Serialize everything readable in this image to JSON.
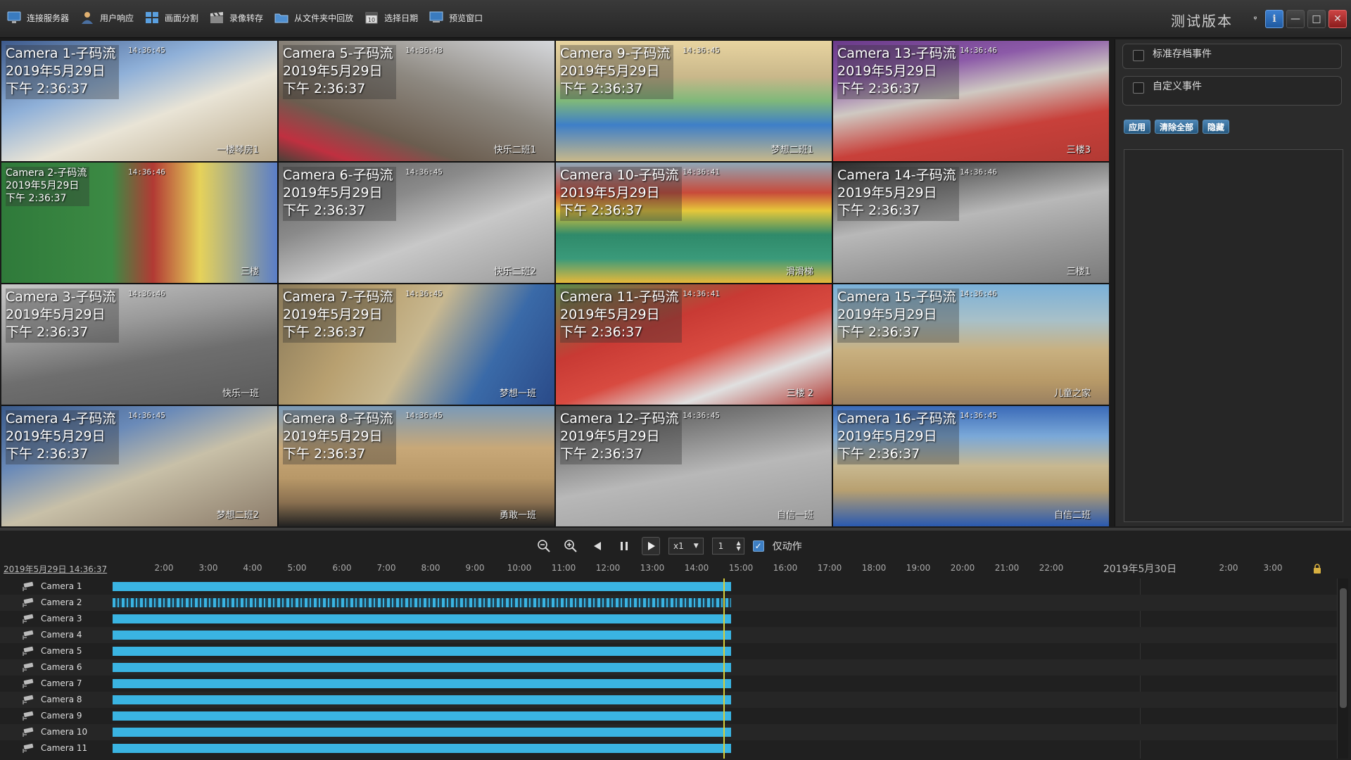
{
  "toolbar": {
    "items": [
      {
        "label": "连接服务器",
        "icon": "server-connect-icon"
      },
      {
        "label": "用户响应",
        "icon": "user-icon"
      },
      {
        "label": "画面分割",
        "icon": "grid-split-icon"
      },
      {
        "label": "录像转存",
        "icon": "clapper-icon"
      },
      {
        "label": "从文件夹中回放",
        "icon": "folder-icon"
      },
      {
        "label": "选择日期",
        "icon": "calendar-icon"
      },
      {
        "label": "预览窗口",
        "icon": "monitor-icon"
      }
    ],
    "brand": "测试版本",
    "window_buttons": {
      "pin": "ᵠ",
      "info": "i",
      "minimize": "—",
      "maximize": "□",
      "close": "✕"
    }
  },
  "cameras": [
    {
      "title": "Camera 1-子码流",
      "date": "2019年5月29日",
      "time": "下午 2:36:37",
      "osd_time": "14:36:45",
      "room": "一楼琴房1"
    },
    {
      "title": "Camera 5-子码流",
      "date": "2019年5月29日",
      "time": "下午 2:36:37",
      "osd_time": "14:36:43",
      "room": "快乐二班1"
    },
    {
      "title": "Camera 9-子码流",
      "date": "2019年5月29日",
      "time": "下午 2:36:37",
      "osd_time": "14:36:45",
      "room": "梦想二班1"
    },
    {
      "title": "Camera 13-子码流",
      "date": "2019年5月29日",
      "time": "下午 2:36:37",
      "osd_time": "14:36:46",
      "room": "三楼3"
    },
    {
      "title": "Camera 2-子码流",
      "date": "2019年5月29日",
      "time": "下午 2:36:37",
      "osd_time": "14:36:46",
      "room": "三楼"
    },
    {
      "title": "Camera 6-子码流",
      "date": "2019年5月29日",
      "time": "下午 2:36:37",
      "osd_time": "14:36:45",
      "room": "快乐二班2"
    },
    {
      "title": "Camera 10-子码流",
      "date": "2019年5月29日",
      "time": "下午 2:36:37",
      "osd_time": "14:36:41",
      "room": "滑滑梯"
    },
    {
      "title": "Camera 14-子码流",
      "date": "2019年5月29日",
      "time": "下午 2:36:37",
      "osd_time": "14:36:46",
      "room": "三楼1"
    },
    {
      "title": "Camera 3-子码流",
      "date": "2019年5月29日",
      "time": "下午 2:36:37",
      "osd_time": "14:36:46",
      "room": "快乐一班"
    },
    {
      "title": "Camera 7-子码流",
      "date": "2019年5月29日",
      "time": "下午 2:36:37",
      "osd_time": "14:36:45",
      "room": "梦想一班"
    },
    {
      "title": "Camera 11-子码流",
      "date": "2019年5月29日",
      "time": "下午 2:36:37",
      "osd_time": "14:36:41",
      "room": "三楼 2"
    },
    {
      "title": "Camera 15-子码流",
      "date": "2019年5月29日",
      "time": "下午 2:36:37",
      "osd_time": "14:36:46",
      "room": "儿童之家"
    },
    {
      "title": "Camera 4-子码流",
      "date": "2019年5月29日",
      "time": "下午 2:36:37",
      "osd_time": "14:36:45",
      "room": "梦想二班2"
    },
    {
      "title": "Camera 8-子码流",
      "date": "2019年5月29日",
      "time": "下午 2:36:37",
      "osd_time": "14:36:45",
      "room": "勇敢一班"
    },
    {
      "title": "Camera 12-子码流",
      "date": "2019年5月29日",
      "time": "下午 2:36:37",
      "osd_time": "14:36:45",
      "room": "自信一班"
    },
    {
      "title": "Camera 16-子码流",
      "date": "2019年5月29日",
      "time": "下午 2:36:37",
      "osd_time": "14:36:45",
      "room": "自信二班"
    }
  ],
  "right_panel": {
    "events": [
      {
        "label": "标准存档事件",
        "checked": false
      },
      {
        "label": "自定义事件",
        "checked": false
      }
    ],
    "buttons": {
      "apply": "应用",
      "clear_all": "清除全部",
      "hide": "隐藏"
    }
  },
  "playback": {
    "speed": "x1",
    "step": "1",
    "motion_only_label": "仅动作",
    "motion_only_checked": true
  },
  "timeline": {
    "current": "2019年5月29日 14:36:37",
    "hours": [
      "2:00",
      "3:00",
      "4:00",
      "5:00",
      "6:00",
      "7:00",
      "8:00",
      "9:00",
      "10:00",
      "11:00",
      "12:00",
      "13:00",
      "14:00",
      "15:00",
      "16:00",
      "17:00",
      "18:00",
      "19:00",
      "20:00",
      "21:00",
      "22:00",
      "2019年5月30日",
      "2:00",
      "3:00"
    ],
    "tracks": [
      "Camera 1",
      "Camera 2",
      "Camera 3",
      "Camera 4",
      "Camera 5",
      "Camera 6",
      "Camera 7",
      "Camera 8",
      "Camera 9",
      "Camera 10",
      "Camera 11"
    ]
  },
  "colors": {
    "accent": "#3ab4e2",
    "cursor": "#d6cf3a",
    "button": "#3a72a3"
  }
}
